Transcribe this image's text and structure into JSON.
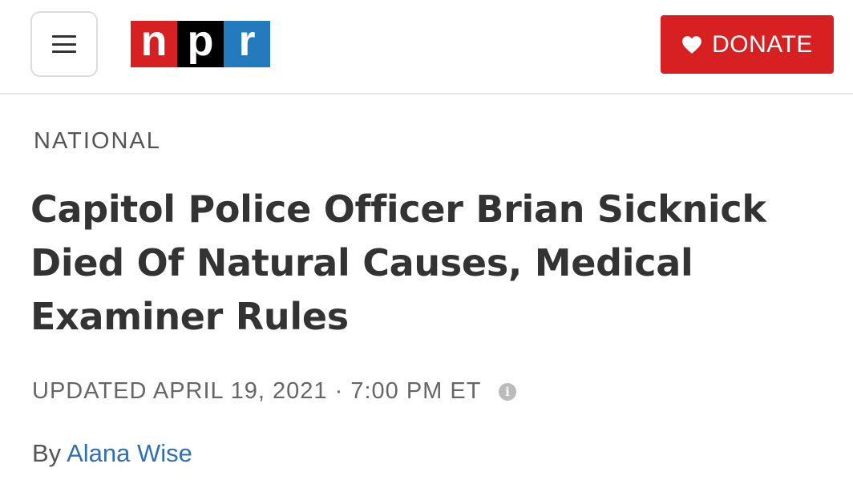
{
  "header": {
    "menu_icon": "hamburger-menu-icon",
    "logo": {
      "letters": [
        "n",
        "p",
        "r"
      ],
      "colors": [
        "#d62021",
        "#000000",
        "#237bbd"
      ]
    },
    "donate": {
      "label": "DONATE",
      "icon": "heart-icon",
      "color": "#d62021"
    }
  },
  "article": {
    "section": "NATIONAL",
    "headline": "Capitol Police Officer Brian Sicknick Died Of Natural Causes, Medical Examiner Rules",
    "updated": "UPDATED APRIL 19, 2021 · 7:00 PM ET",
    "info_icon": "info-icon",
    "byline_prefix": "By ",
    "author": "Alana Wise",
    "author_link_color": "#2f6fb5"
  }
}
